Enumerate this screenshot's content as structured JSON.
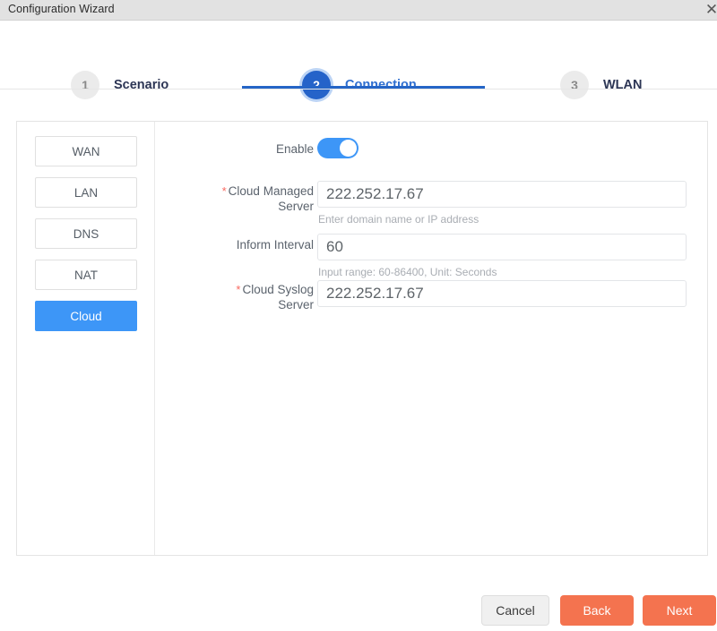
{
  "window": {
    "title": "Configuration Wizard",
    "close_icon": "close-icon",
    "close_glyph": "✕"
  },
  "steps": [
    {
      "number": "1",
      "label": "Scenario",
      "active": false
    },
    {
      "number": "2",
      "label": "Connection",
      "active": true
    },
    {
      "number": "3",
      "label": "WLAN",
      "active": false
    }
  ],
  "sidebar": {
    "items": [
      {
        "label": "WAN",
        "selected": false
      },
      {
        "label": "LAN",
        "selected": false
      },
      {
        "label": "DNS",
        "selected": false
      },
      {
        "label": "NAT",
        "selected": false
      },
      {
        "label": "Cloud",
        "selected": true
      }
    ]
  },
  "form": {
    "enable": {
      "label": "Enable",
      "state": "on"
    },
    "cloud_managed_server": {
      "label": "Cloud Managed Server",
      "required": true,
      "value": "222.252.17.67",
      "placeholder": "",
      "hint": "Enter domain name or IP address"
    },
    "inform_interval": {
      "label": "Inform Interval",
      "required": false,
      "value": "60",
      "placeholder": "",
      "hint": "Input range: 60-86400, Unit: Seconds"
    },
    "cloud_syslog_server": {
      "label": "Cloud Syslog Server",
      "required": true,
      "value": "222.252.17.67",
      "placeholder": "",
      "hint": ""
    }
  },
  "footer": {
    "cancel_label": "Cancel",
    "back_label": "Back",
    "next_label": "Next"
  },
  "colors": {
    "accent_blue": "#3d96f7",
    "step_active_blue": "#2563c9",
    "primary_orange": "#f4734f",
    "required_red": "#f9685f",
    "titlebar_gray": "#e2e2e2"
  }
}
